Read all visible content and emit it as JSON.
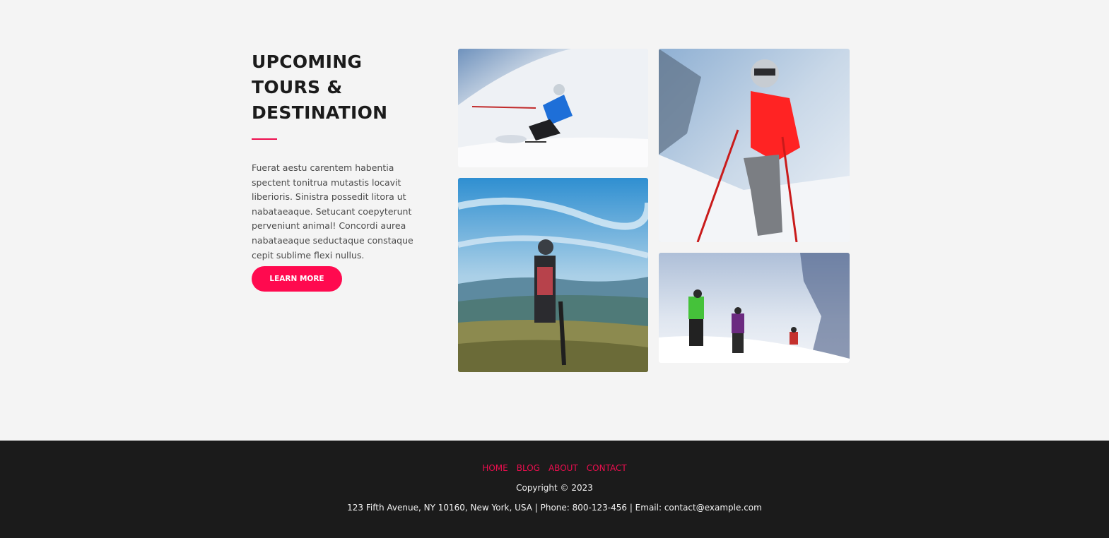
{
  "tours": {
    "heading": "UPCOMING TOURS & DESTINATION",
    "description": "Fuerat aestu carentem habentia spectent tonitrua mutastis locavit liberioris. Sinistra possedit litora ut nabataeaque. Setucant coepyterunt perveniunt animal! Concordi aurea nabataeaque seductaque constaque cepit sublime flexi nullus.",
    "cta_label": "LEARN MORE",
    "accent_color": "#ee0e4f",
    "button_color": "#ff0a4f"
  },
  "gallery": [
    {
      "subject": "skier-blue-jacket-downhill"
    },
    {
      "subject": "mountain-biker-overlook"
    },
    {
      "subject": "skier-red-jacket-slope"
    },
    {
      "subject": "ski-touring-group-ascent"
    }
  ],
  "footer": {
    "nav": [
      "HOME",
      "BLOG",
      "ABOUT",
      "CONTACT"
    ],
    "copyright": "Copyright © 2023",
    "address": "123 Fifth Avenue, NY 10160, New York, USA | Phone: 800-123-456 | Email: contact@example.com",
    "background": "#1b1b1b"
  }
}
